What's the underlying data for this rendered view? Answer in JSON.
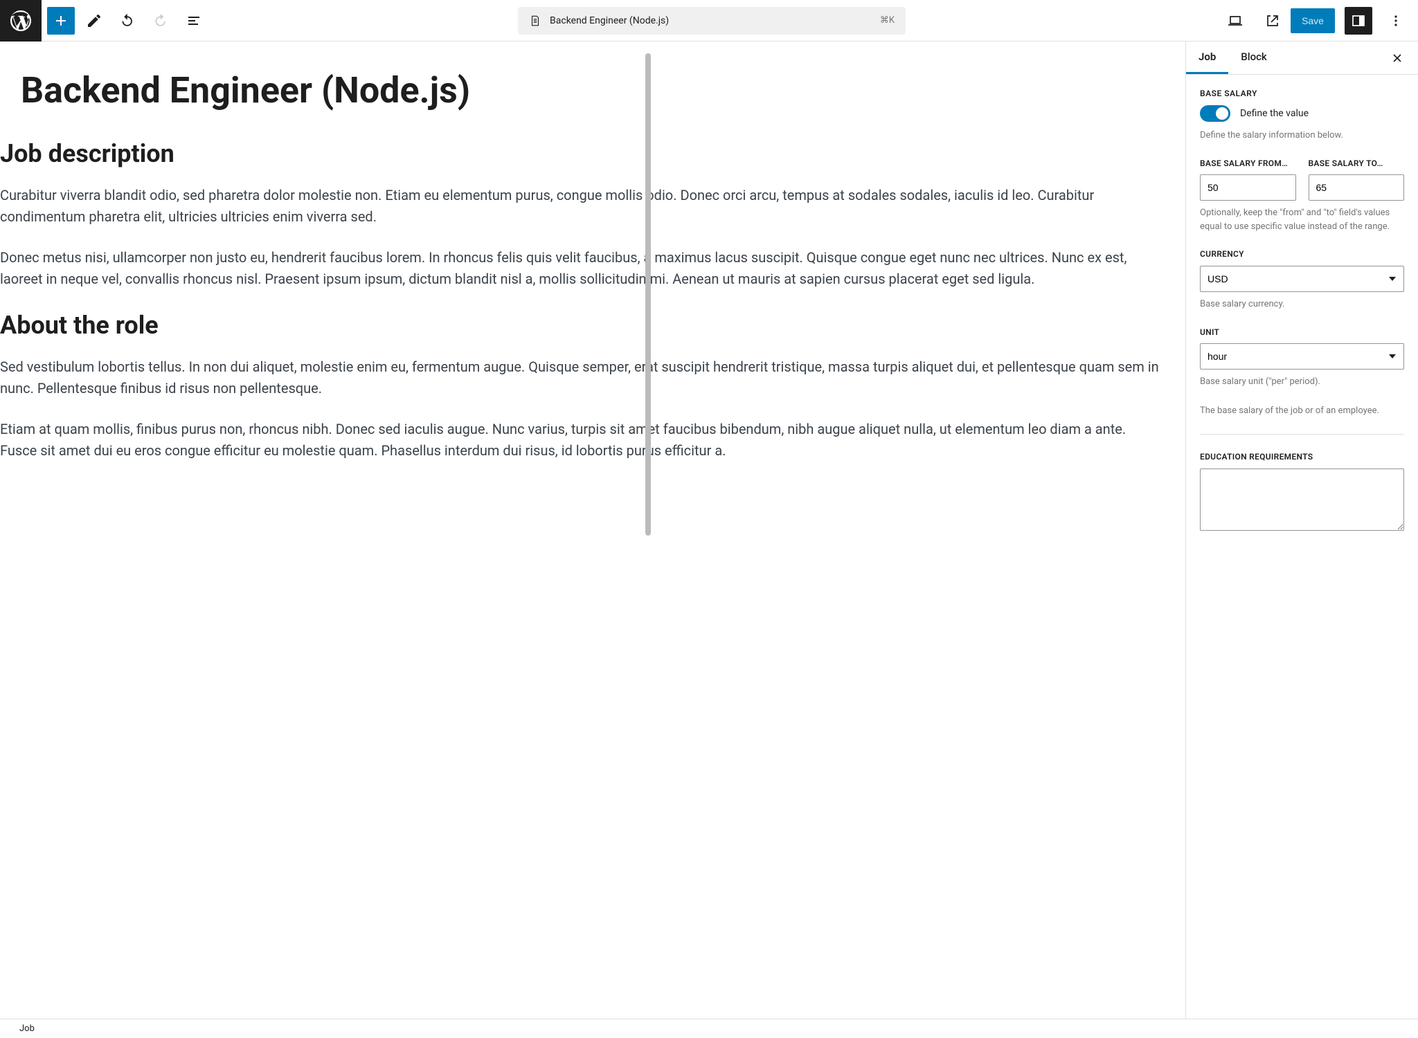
{
  "topbar": {
    "doc_title": "Backend Engineer (Node.js)",
    "shortcut": "⌘K",
    "save_label": "Save"
  },
  "editor": {
    "title": "Backend Engineer (Node.js)",
    "h2_a": "Job description",
    "p1": "Curabitur viverra blandit odio, sed pharetra dolor molestie non. Etiam eu elementum purus, congue mollis odio. Donec orci arcu, tempus at sodales sodales, iaculis id leo. Curabitur condimentum pharetra elit, ultricies ultricies enim viverra sed.",
    "p2": "Donec metus nisi, ullamcorper non justo eu, hendrerit faucibus lorem. In rhoncus felis quis velit faucibus, a maximus lacus suscipit. Quisque congue eget nunc nec ultrices. Nunc ex est, laoreet in neque vel, convallis rhoncus nisl. Praesent ipsum ipsum, dictum blandit nisl a, mollis sollicitudin mi. Aenean ut mauris at sapien cursus placerat eget sed ligula.",
    "h2_b": "About the role",
    "p3": "Sed vestibulum lobortis tellus. In non dui aliquet, molestie enim eu, fermentum augue. Quisque semper, erat suscipit hendrerit tristique, massa turpis aliquet dui, et pellentesque quam sem in nunc. Pellentesque finibus id risus non pellentesque.",
    "p4": "Etiam at quam mollis, finibus purus non, rhoncus nibh. Donec sed iaculis augue. Nunc varius, turpis sit amet faucibus bibendum, nibh augue aliquet nulla, ut elementum leo diam a ante. Fusce sit amet dui eu eros congue efficitur eu molestie quam. Phasellus interdum dui risus, id lobortis purus efficitur a."
  },
  "sidebar": {
    "tabs": {
      "job": "Job",
      "block": "Block"
    },
    "base_salary": {
      "heading": "BASE SALARY",
      "toggle_label": "Define the value",
      "help_top": "Define the salary information below.",
      "from_label": "BASE SALARY FROM…",
      "to_label": "BASE SALARY TO…",
      "from_value": "50",
      "to_value": "65",
      "range_help": "Optionally, keep the \"from\" and \"to\" field's values equal to use specific value instead of the range.",
      "currency_label": "CURRENCY",
      "currency_value": "USD",
      "currency_help": "Base salary currency.",
      "unit_label": "UNIT",
      "unit_value": "hour",
      "unit_help": "Base salary unit (\"per\" period).",
      "footer_help": "The base salary of the job or of an employee."
    },
    "edu": {
      "label": "EDUCATION REQUIREMENTS",
      "value": ""
    }
  },
  "footer": {
    "breadcrumb": "Job"
  }
}
